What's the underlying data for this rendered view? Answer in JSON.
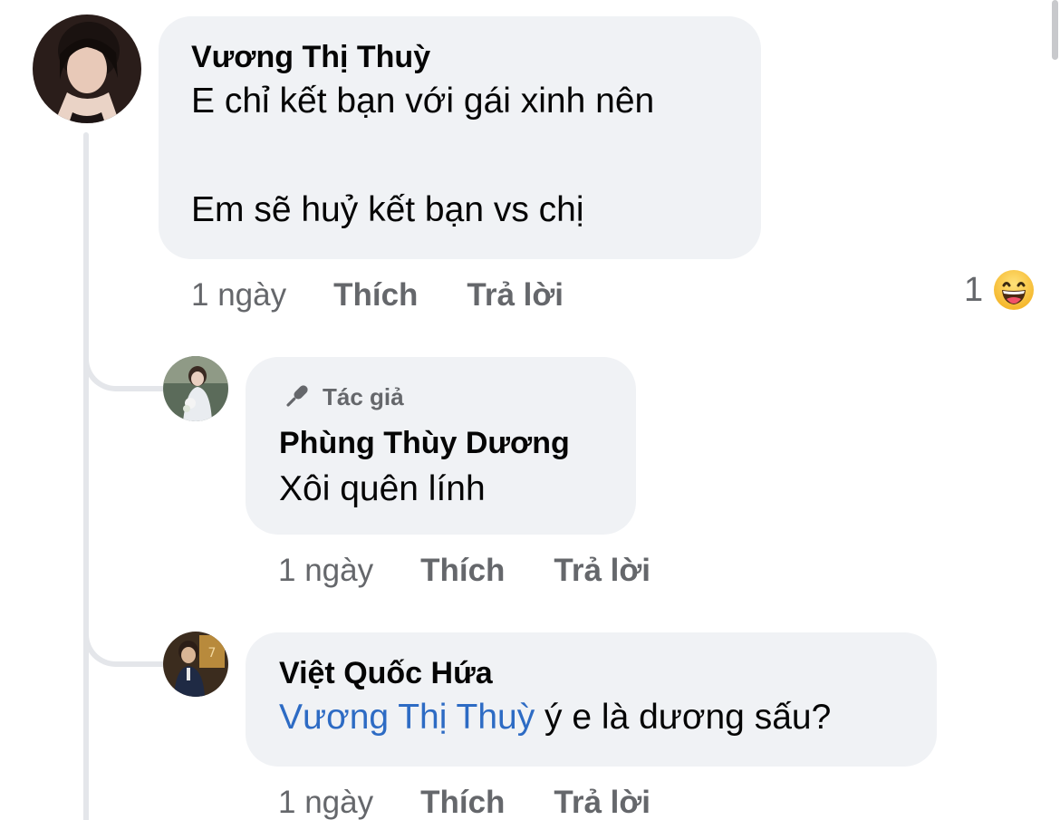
{
  "comments": [
    {
      "author": "Vương Thị Thuỳ",
      "lines": [
        "E chỉ kết bạn với gái xinh nên",
        "",
        "Em sẽ huỷ kết bạn vs chị"
      ],
      "time": "1 ngày",
      "like_label": "Thích",
      "reply_label": "Trả lời",
      "reaction": {
        "count": "1",
        "icon": "haha-emoji-icon"
      }
    }
  ],
  "replies": [
    {
      "badge_label": "Tác giả",
      "badge_icon": "microphone-icon",
      "author": "Phùng Thùy Dương",
      "text": "Xôi quên lính",
      "time": "1 ngày",
      "like_label": "Thích",
      "reply_label": "Trả lời"
    },
    {
      "author": "Việt Quốc Hứa",
      "mention": "Vương Thị Thuỳ",
      "text": " ý e là dương sấu?",
      "time": "1 ngày",
      "like_label": "Thích",
      "reply_label": "Trả lời"
    }
  ],
  "colors": {
    "bubble_bg": "#f0f2f5",
    "meta_text": "#65676b",
    "mention": "#2d6bc4",
    "thread_line": "#e4e6ea"
  }
}
